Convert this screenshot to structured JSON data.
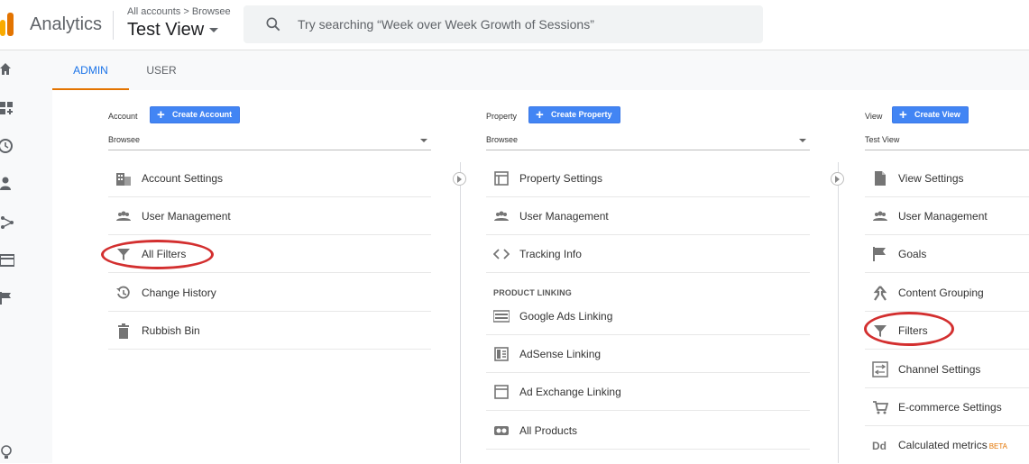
{
  "header": {
    "app_name": "Analytics",
    "breadcrumb": "All accounts > Browsee",
    "view_title": "Test View",
    "search_placeholder": "Try searching “Week over Week Growth of Sessions”"
  },
  "leftnav": {
    "icons": [
      "home-icon",
      "customization-icon",
      "realtime-icon",
      "audience-icon",
      "acquisition-icon",
      "behavior-icon",
      "conversions-icon",
      "discover-icon"
    ]
  },
  "tabs": [
    {
      "label": "ADMIN",
      "active": true
    },
    {
      "label": "USER",
      "active": false
    }
  ],
  "account": {
    "label": "Account",
    "create_label": "Create Account",
    "selected": "Browsee",
    "items": [
      {
        "label": "Account Settings",
        "icon": "building-icon"
      },
      {
        "label": "User Management",
        "icon": "people-icon"
      },
      {
        "label": "All Filters",
        "icon": "filter-icon"
      },
      {
        "label": "Change History",
        "icon": "history-icon"
      },
      {
        "label": "Rubbish Bin",
        "icon": "trash-icon"
      }
    ]
  },
  "property": {
    "label": "Property",
    "create_label": "Create Property",
    "selected": "Browsee",
    "items": [
      {
        "label": "Property Settings",
        "icon": "window-icon"
      },
      {
        "label": "User Management",
        "icon": "people-icon"
      },
      {
        "label": "Tracking Info",
        "icon": "code-icon"
      }
    ],
    "section_title": "PRODUCT LINKING",
    "linking_items": [
      {
        "label": "Google Ads Linking",
        "icon": "ads-icon"
      },
      {
        "label": "AdSense Linking",
        "icon": "adsense-icon"
      },
      {
        "label": "Ad Exchange Linking",
        "icon": "adexchange-icon"
      },
      {
        "label": "All Products",
        "icon": "link-icon"
      }
    ]
  },
  "view": {
    "label": "View",
    "create_label": "Create View",
    "selected": "Test View",
    "items": [
      {
        "label": "View Settings",
        "icon": "document-icon"
      },
      {
        "label": "User Management",
        "icon": "people-icon"
      },
      {
        "label": "Goals",
        "icon": "flag-icon"
      },
      {
        "label": "Content Grouping",
        "icon": "grouping-icon"
      },
      {
        "label": "Filters",
        "icon": "filter-icon"
      },
      {
        "label": "Channel Settings",
        "icon": "channel-icon"
      },
      {
        "label": "E-commerce Settings",
        "icon": "cart-icon"
      },
      {
        "label": "Calculated metrics",
        "icon": "dd-icon",
        "badge": "BETA"
      }
    ]
  },
  "colors": {
    "accent": "#1a73e8",
    "button": "#4285f4",
    "tab_underline": "#e37400",
    "annotation": "#d32f2f"
  }
}
